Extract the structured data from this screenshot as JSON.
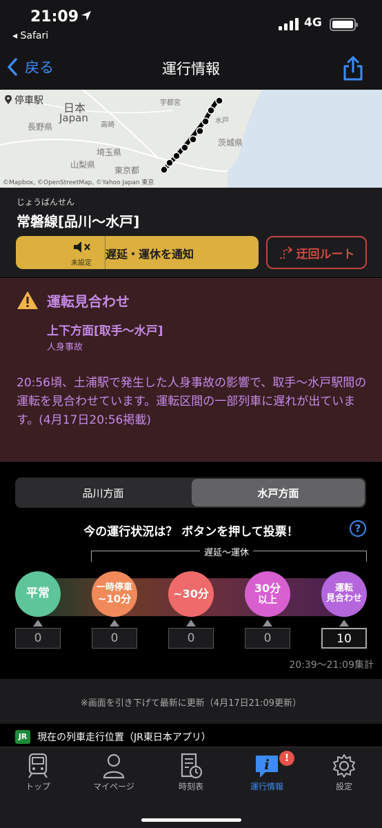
{
  "status_bar": {
    "time": "21:09",
    "back_app": "◂ Safari",
    "network": "4G"
  },
  "nav": {
    "back_label": "戻る",
    "title": "運行情報"
  },
  "map": {
    "stop_label": "停車駅",
    "labels": {
      "japan_kanji": "日本",
      "japan": "Japan",
      "nagano": "長野県",
      "utsunomiya": "宇都宮",
      "takasaki": "高崎",
      "mito": "水戸",
      "ibaraki": "茨城県",
      "saitama": "埼玉県",
      "yamanashi": "山梨県",
      "tokyo": "東京都"
    },
    "attribution": "©Mapbox, ©OpenStreetMap, ©Yahoo Japan  東京"
  },
  "line": {
    "kana": "じょうばんせん",
    "name": "常磐線[品川〜水戸]",
    "mute_label": "未設定",
    "notify_label": "遅延・運休を通知",
    "detour_label": "迂回ルート"
  },
  "alert": {
    "title": "運転見合わせ",
    "section": "上下方面[取手〜水戸]",
    "cause": "人身事故",
    "body": "20:56頃、土浦駅で発生した人身事故の影響で、取手〜水戸駅間の運転を見合わせています。運転区間の一部列車に遅れが出ています。(4月17日20:56掲載)"
  },
  "direction_tabs": {
    "left": "品川方面",
    "right": "水戸方面"
  },
  "vote": {
    "question": "今の運行状況は？ ボタンを押して投票！",
    "help": "?",
    "delay_range_label": "遅延〜運休",
    "options": [
      {
        "line1": "平常",
        "line2": "",
        "count": "0",
        "color": "#5ec49a"
      },
      {
        "line1": "一時停車",
        "line2": "~10分",
        "count": "0",
        "color": "#f08a5a"
      },
      {
        "line1": "~30分",
        "line2": "",
        "count": "0",
        "color": "#ef6b6b"
      },
      {
        "line1": "30分",
        "line2": "以上",
        "count": "0",
        "color": "#d75fd0"
      },
      {
        "line1": "運転",
        "line2": "見合わせ",
        "count": "10",
        "color": "#b466dc"
      }
    ],
    "tally": "20:39〜21:09集計"
  },
  "refresh_note": "※画面を引き下げて最新に更新（4月17日21:09更新）",
  "jr_row": {
    "logo": "JR",
    "label": "現在の列車走行位置（JR東日本アプリ）"
  },
  "tab_bar": {
    "items": [
      "トップ",
      "マイページ",
      "時刻表",
      "運行情報",
      "設定"
    ],
    "badge": "!"
  }
}
